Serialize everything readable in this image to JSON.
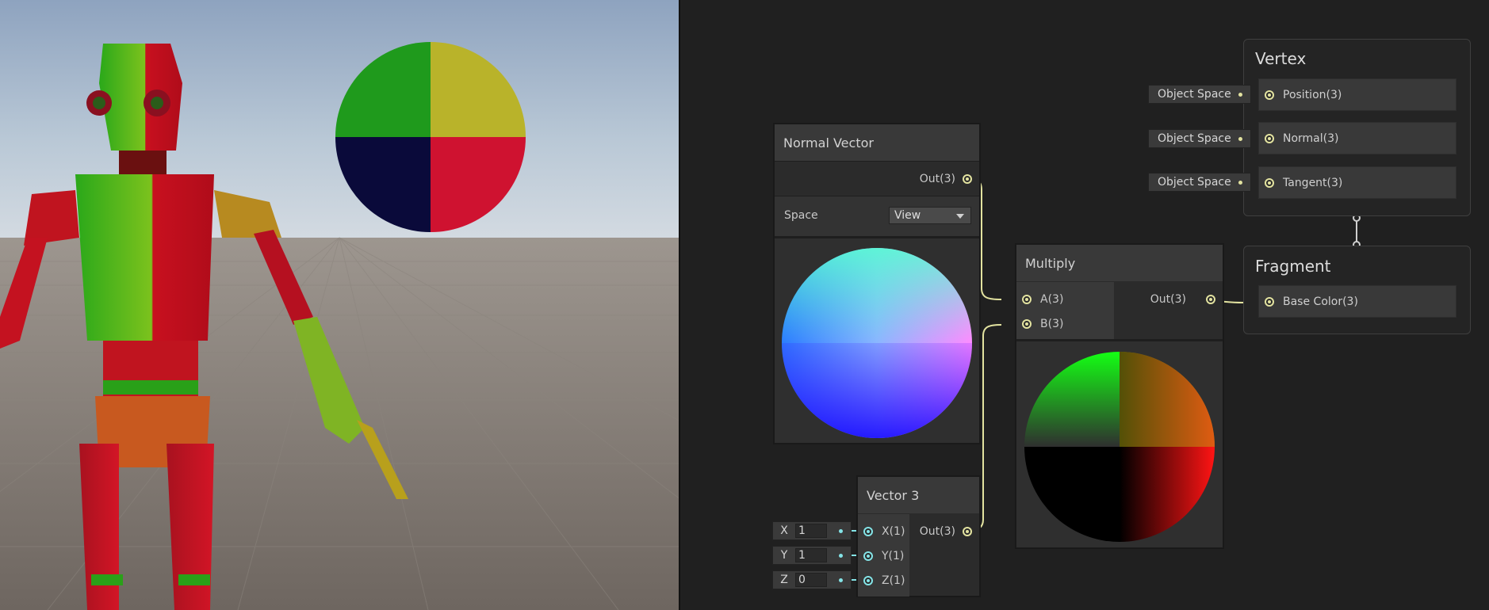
{
  "graph": {
    "normal_vector": {
      "title": "Normal Vector",
      "output": "Out(3)",
      "space_label": "Space",
      "space_value": "View"
    },
    "multiply": {
      "title": "Multiply",
      "input_a": "A(3)",
      "input_b": "B(3)",
      "output": "Out(3)"
    },
    "vector3": {
      "title": "Vector 3",
      "input_x": "X(1)",
      "input_y": "Y(1)",
      "input_z": "Z(1)",
      "output": "Out(3)",
      "fields": [
        {
          "axis": "X",
          "value": "1"
        },
        {
          "axis": "Y",
          "value": "1"
        },
        {
          "axis": "Z",
          "value": "0"
        }
      ]
    },
    "vertex": {
      "title": "Vertex",
      "blocks": [
        "Position(3)",
        "Normal(3)",
        "Tangent(3)"
      ],
      "space_inputs": [
        "Object Space",
        "Object Space",
        "Object Space"
      ]
    },
    "fragment": {
      "title": "Fragment",
      "blocks": [
        "Base Color(3)"
      ]
    }
  },
  "colors": {
    "wire": "#e3e3a0",
    "float_port": "#84e4e7",
    "graph_background": "#202020",
    "node_title": "#393939"
  },
  "icons": {
    "port": "port-dot-icon",
    "dropdown": "caret-down-icon"
  }
}
